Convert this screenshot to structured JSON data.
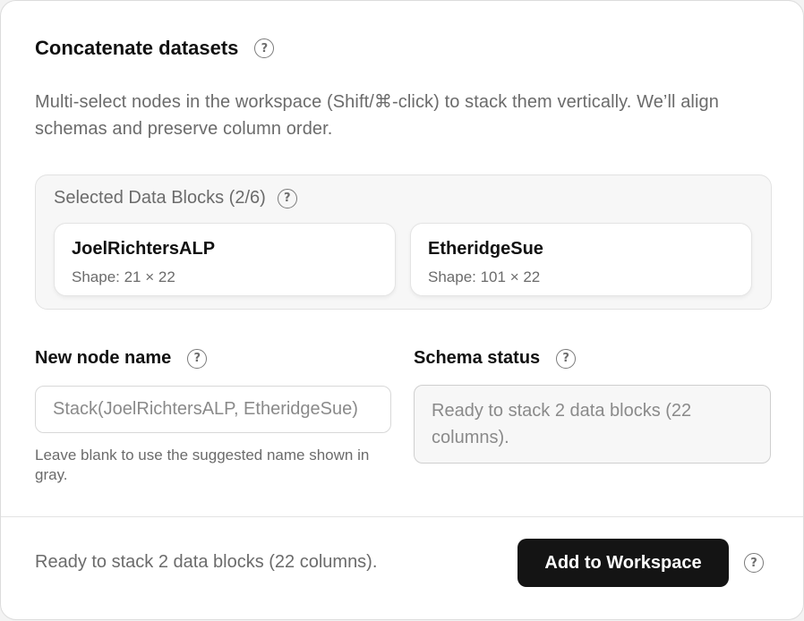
{
  "header": {
    "title": "Concatenate datasets",
    "help_icon": "question-circle-icon"
  },
  "description": "Multi-select nodes in the workspace (Shift/⌘-click) to stack them vertically. We’ll align schemas and preserve column order.",
  "selected_blocks": {
    "label": "Selected Data Blocks (2/6)",
    "help_icon": "question-circle-icon",
    "items": [
      {
        "name": "JoelRichtersALP",
        "shape": "Shape: 21 × 22"
      },
      {
        "name": "EtheridgeSue",
        "shape": "Shape: 101 × 22"
      }
    ]
  },
  "new_node": {
    "label": "New node name",
    "help_icon": "question-circle-icon",
    "value": "",
    "placeholder": "Stack(JoelRichtersALP, EtheridgeSue)",
    "hint": "Leave blank to use the suggested name shown in gray."
  },
  "schema_status": {
    "label": "Schema status",
    "help_icon": "question-circle-icon",
    "text": "Ready to stack 2 data blocks (22 columns)."
  },
  "footer": {
    "status": "Ready to stack 2 data blocks (22 columns).",
    "add_button_label": "Add to Workspace",
    "help_icon": "question-circle-icon"
  },
  "colors": {
    "primary_button": "#141414",
    "muted_text": "#6b6b6b",
    "panel_background": "#f7f7f7"
  }
}
